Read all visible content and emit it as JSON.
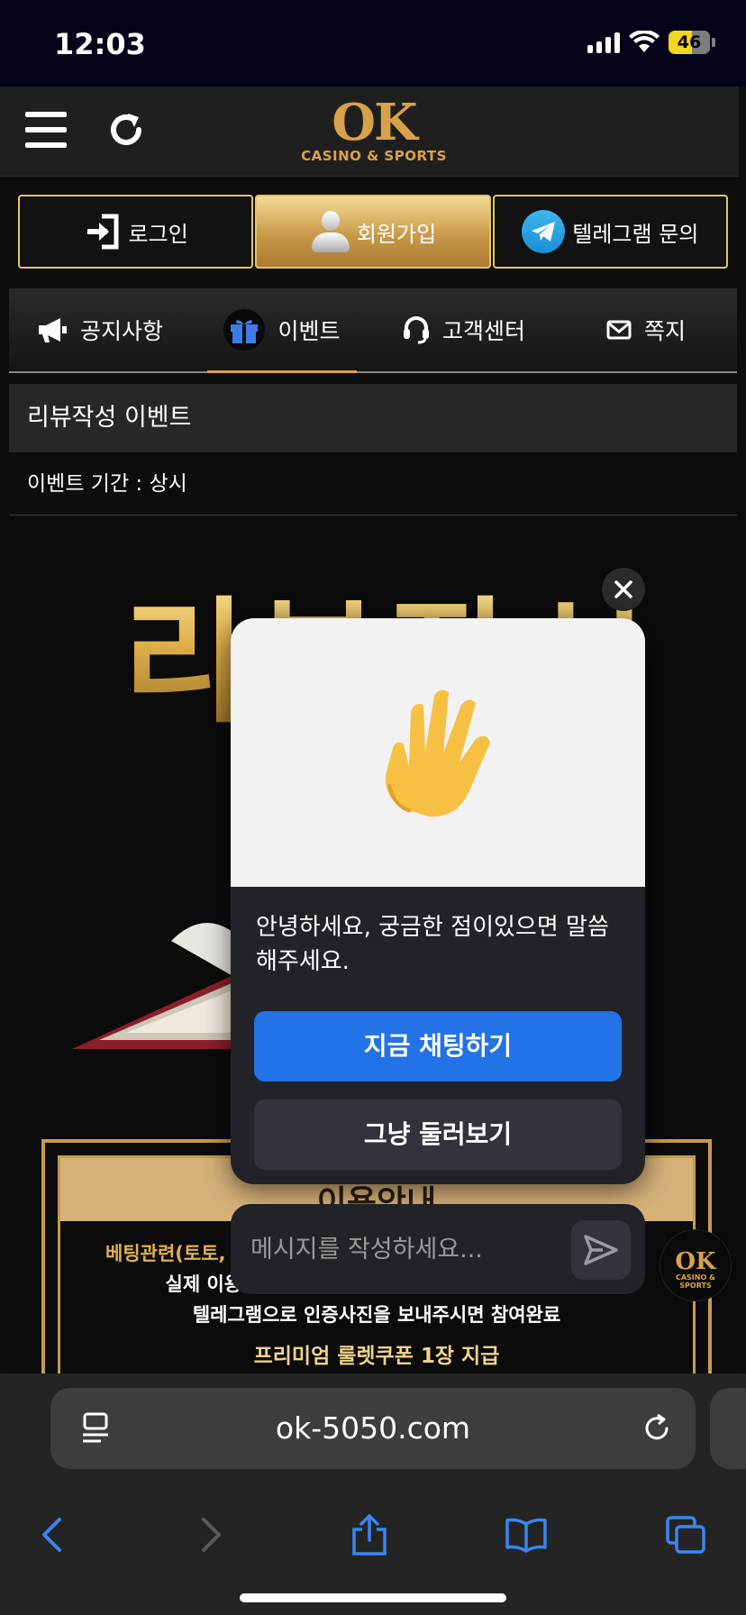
{
  "status_bar": {
    "time": "12:03",
    "battery_level": "46"
  },
  "header": {
    "logo_main": "OK",
    "logo_sub": "CASINO & SPORTS"
  },
  "auth": {
    "login_label": "로그인",
    "signup_label": "회원가입",
    "telegram_label": "텔레그램 문의"
  },
  "nav": {
    "items": [
      {
        "label": "공지사항",
        "icon": "megaphone-icon"
      },
      {
        "label": "이벤트",
        "icon": "gift-icon",
        "active": true
      },
      {
        "label": "고객센터",
        "icon": "headset-icon"
      },
      {
        "label": "쪽지",
        "icon": "envelope-icon"
      }
    ]
  },
  "event": {
    "title": "리뷰작성 이벤트",
    "period": "이벤트 기간 : 상시"
  },
  "banner": {
    "headline": "리뷰작성",
    "info_head": "이용안내",
    "line1": "베팅관련(토토,",
    "line2": "실제 이용후기 및 사진을 첨부해서 글을 작성해주세요",
    "line3": "텔레그램으로 인증사진을 보내주시면 참여완료",
    "line4": "프리미엄 룰렛쿠폰 1장 지급"
  },
  "chat_popup": {
    "emoji": "✋",
    "message": "안녕하세요, 궁금한 점이있으면 말씀해주세요.",
    "chat_now": "지금 채팅하기",
    "just_browse": "그냥 둘러보기"
  },
  "message_bar": {
    "placeholder": "메시지를 작성하세요..."
  },
  "launcher": {
    "logo_main": "OK",
    "logo_sub": "CASINO & SPORTS"
  },
  "browser": {
    "url": "ok-5050.com"
  },
  "colors": {
    "gold": "#d9a24a",
    "auth_border": "#e3c766",
    "primary_button": "#2372e6",
    "popup_bg": "#222328",
    "battery": "#f6d51f"
  }
}
